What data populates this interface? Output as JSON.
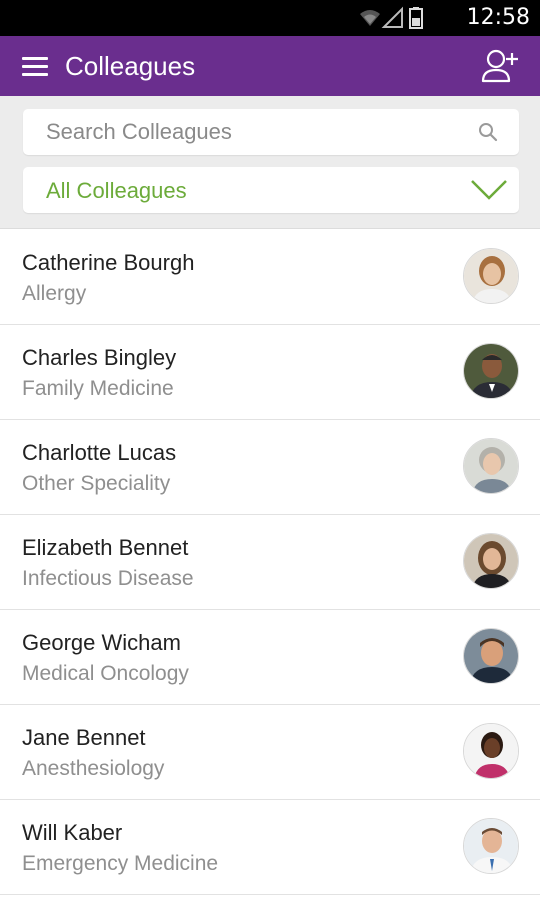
{
  "status_bar": {
    "time": "12:58"
  },
  "app_bar": {
    "title": "Colleagues",
    "menu_icon": "hamburger-menu-icon",
    "action_icon": "add-person-icon"
  },
  "search": {
    "placeholder": "Search Colleagues",
    "value": ""
  },
  "filter": {
    "selected": "All Colleagues",
    "accent_color": "#6cab3a"
  },
  "theme": {
    "primary": "#6a2e8e"
  },
  "colleagues": [
    {
      "name": "Catherine Bourgh",
      "specialty": "Allergy"
    },
    {
      "name": "Charles Bingley",
      "specialty": "Family Medicine"
    },
    {
      "name": "Charlotte Lucas",
      "specialty": "Other Speciality"
    },
    {
      "name": "Elizabeth Bennet",
      "specialty": "Infectious Disease"
    },
    {
      "name": "George Wicham",
      "specialty": "Medical Oncology"
    },
    {
      "name": "Jane Bennet",
      "specialty": "Anesthesiology"
    },
    {
      "name": "Will Kaber",
      "specialty": "Emergency Medicine"
    }
  ]
}
